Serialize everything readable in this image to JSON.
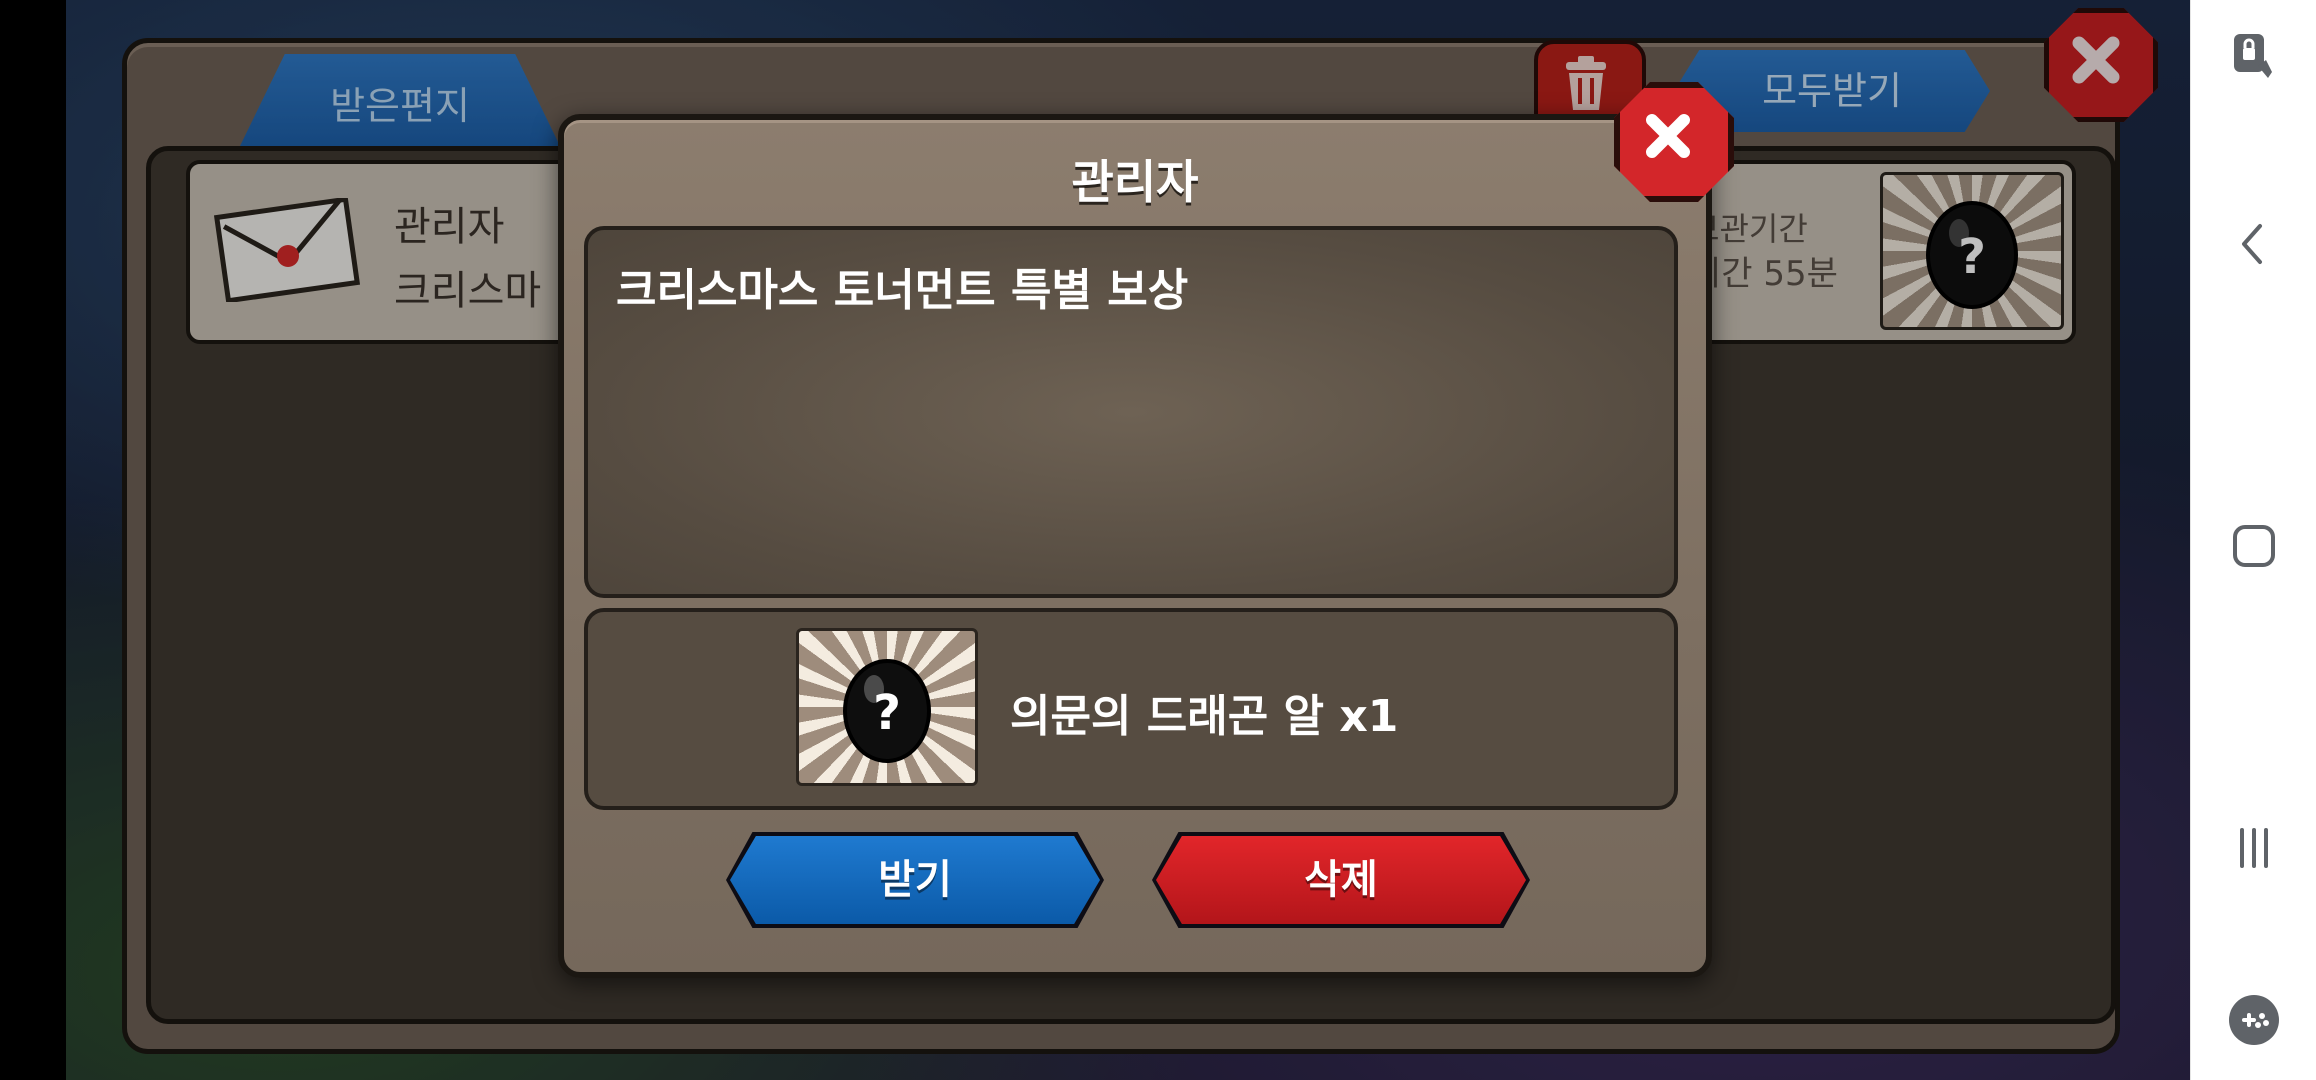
{
  "mailbox": {
    "tab_label": "받은편지",
    "collect_all_label": "모두받기",
    "trash_icon": "trash-icon",
    "close_icon": "close-icon",
    "item": {
      "sender": "관리자",
      "preview": "크리스마",
      "expire_line1": "보관기간",
      "expire_line2": "시간 55분",
      "reward_icon": "mystery-egg-icon"
    }
  },
  "popup": {
    "title": "관리자",
    "message": "크리스마스 토너먼트 특별 보상",
    "reward_label": "의문의 드래곤 알 x1",
    "reward_icon": "mystery-egg-icon",
    "receive_label": "받기",
    "delete_label": "삭제",
    "colors": {
      "receive": "#0b5aa8",
      "delete": "#c1181d",
      "panel": "#8c7d6e"
    }
  },
  "navbar": {
    "icons": [
      "touch-lock-icon",
      "back-icon",
      "home-icon",
      "recents-icon",
      "game-tools-icon"
    ]
  }
}
